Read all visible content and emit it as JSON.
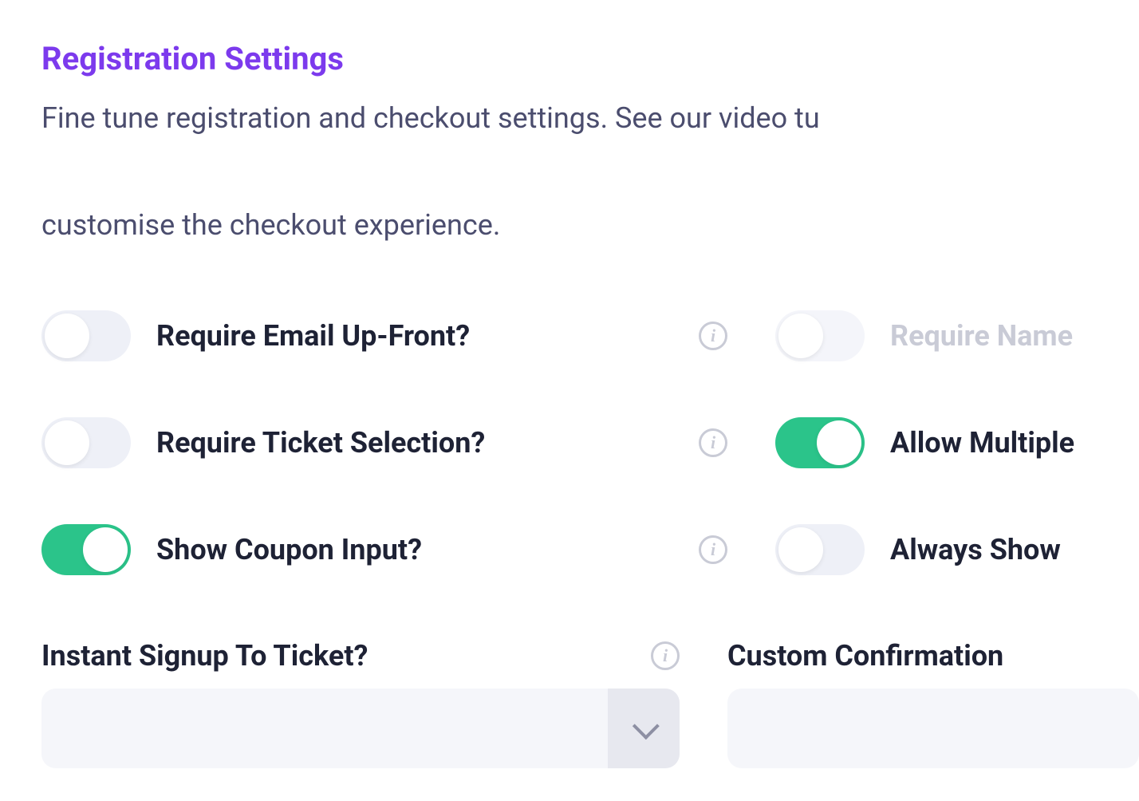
{
  "heading": "Registration Settings",
  "description_line1": "Fine tune registration and checkout settings. See our video tu",
  "description_line2": "customise the checkout experience.",
  "settings": {
    "require_email": {
      "label": "Require Email Up-Front?",
      "on": false,
      "disabled": false
    },
    "require_name": {
      "label": "Require Name",
      "on": false,
      "disabled": true
    },
    "require_ticket": {
      "label": "Require Ticket Selection?",
      "on": false,
      "disabled": false
    },
    "allow_multiple": {
      "label": "Allow Multiple",
      "on": true,
      "disabled": false
    },
    "show_coupon": {
      "label": "Show Coupon Input?",
      "on": true,
      "disabled": false
    },
    "always_show": {
      "label": "Always Show ",
      "on": false,
      "disabled": false
    }
  },
  "selects": {
    "instant_signup": {
      "label": "Instant Signup To Ticket?",
      "value": ""
    },
    "custom_confirmation": {
      "label": "Custom Confirmation ",
      "value": ""
    }
  }
}
